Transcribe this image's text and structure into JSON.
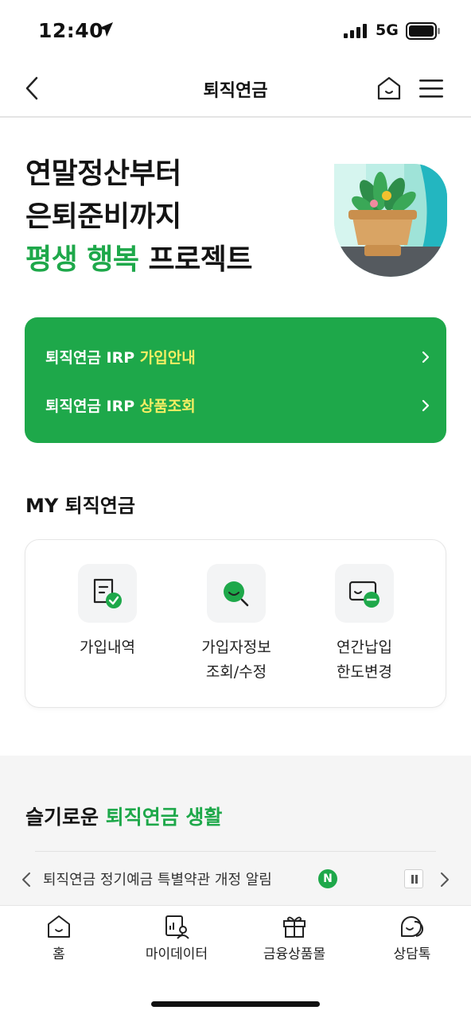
{
  "status_bar": {
    "time": "12:40",
    "network": "5G"
  },
  "header": {
    "title": "퇴직연금"
  },
  "hero": {
    "line1": "연말정산부터",
    "line2": "은퇴준비까지",
    "line3_green": "평생 행복",
    "line3_rest": " 프로젝트"
  },
  "green_card": {
    "items": [
      {
        "prefix": "퇴직연금 IRP ",
        "highlight": "가입안내"
      },
      {
        "prefix": "퇴직연금 IRP ",
        "highlight": "상품조회"
      }
    ]
  },
  "my_section": {
    "title": "MY 퇴직연금",
    "items": [
      {
        "line1": "가입내역",
        "line2": "",
        "icon": "document-check-icon"
      },
      {
        "line1": "가입자정보",
        "line2": "조회/수정",
        "icon": "search-user-icon"
      },
      {
        "line1": "연간납입",
        "line2": "한도변경",
        "icon": "limit-minus-icon"
      }
    ]
  },
  "wise_section": {
    "title_prefix": "슬기로운 ",
    "title_green": "퇴직연금 생활",
    "notice_text": "퇴직연금 정기예금 특별약관 개정 알림",
    "notice_badge": "N"
  },
  "tabbar": {
    "items": [
      {
        "label": "홈",
        "icon": "home-icon"
      },
      {
        "label": "마이데이터",
        "icon": "mydata-icon"
      },
      {
        "label": "금융상품몰",
        "icon": "gift-icon"
      },
      {
        "label": "상담톡",
        "icon": "chat-icon"
      }
    ]
  },
  "colors": {
    "brand_green": "#1ea84a",
    "highlight_yellow": "#f5ee63"
  }
}
